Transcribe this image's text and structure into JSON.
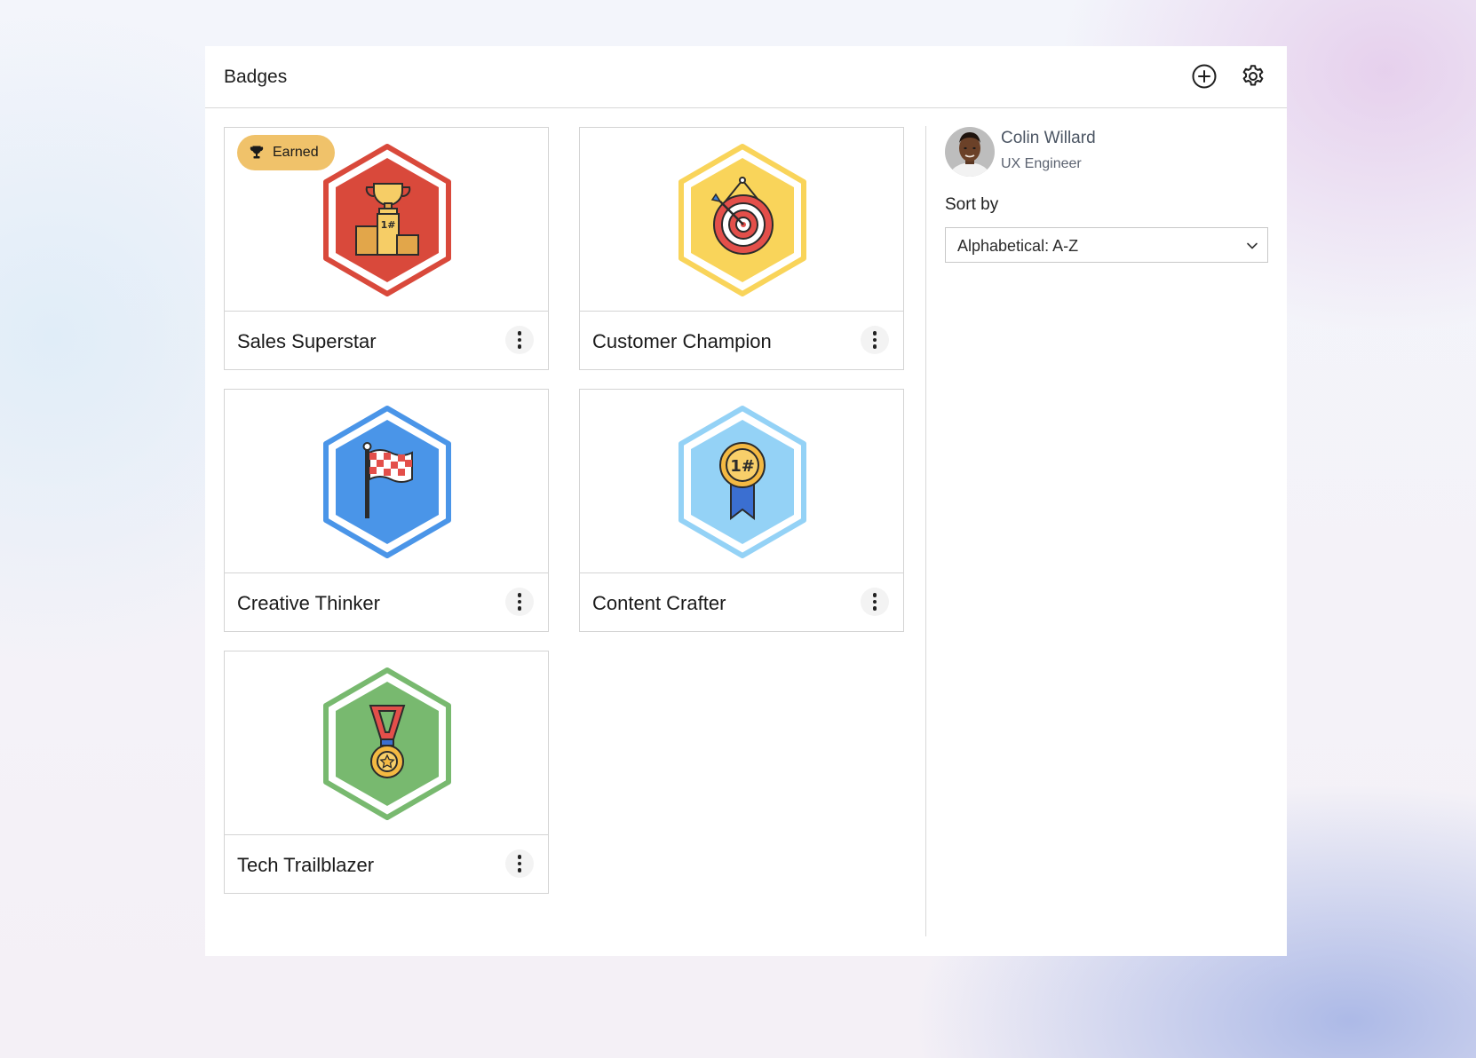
{
  "header": {
    "title": "Badges",
    "add_icon": "plus-circle-icon",
    "settings_icon": "gear-icon"
  },
  "badges": [
    {
      "title": "Sales Superstar",
      "earned": true,
      "earned_label": "Earned",
      "icon": "trophy-podium-icon",
      "color": "#d9493b",
      "ring": "#d9493b"
    },
    {
      "title": "Customer Champion",
      "earned": false,
      "icon": "target-dart-icon",
      "color": "#f9d45a",
      "ring": "#f9d45a"
    },
    {
      "title": "Creative Thinker",
      "earned": false,
      "icon": "checkered-flag-icon",
      "color": "#4a95e8",
      "ring": "#4a95e8"
    },
    {
      "title": "Content Crafter",
      "earned": false,
      "icon": "ribbon-medal-icon",
      "color": "#94d2f6",
      "ring": "#94d2f6"
    },
    {
      "title": "Tech Trailblazer",
      "earned": false,
      "icon": "star-medal-icon",
      "color": "#78b96f",
      "ring": "#78b96f"
    }
  ],
  "user": {
    "name": "Colin Willard",
    "role": "UX Engineer"
  },
  "sort": {
    "label": "Sort by",
    "value": "Alphabetical: A-Z"
  }
}
